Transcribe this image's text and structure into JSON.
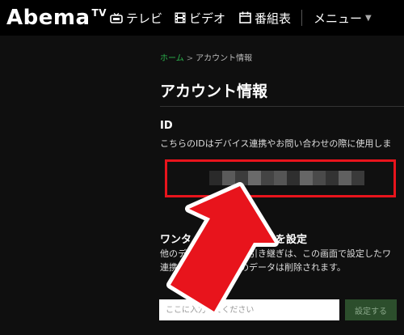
{
  "header": {
    "logo_text": "Abema",
    "logo_sup": "TV",
    "nav": {
      "tv_label": "テレビ",
      "video_label": "ビデオ",
      "guide_label": "番組表",
      "menu_label": "メニュー"
    }
  },
  "breadcrumb": {
    "home": "ホーム",
    "separator": ">",
    "current": "アカウント情報"
  },
  "page": {
    "title": "アカウント情報",
    "id_section": {
      "label": "ID",
      "description": "こちらのIDはデバイス連携やお問い合わせの際に使用しま"
    },
    "otp_section": {
      "title": "ワンタ　　　　　　ードを設定",
      "desc_line1": "他のデ　　　のデータ引き継ぎは、この画面で設定したワ",
      "desc_line2": "連携　　　　リストのデータは削除されます。"
    },
    "input": {
      "placeholder": "ここに入力してください",
      "value": ""
    },
    "set_button_label": "設定する"
  },
  "colors": {
    "background": "#0f0f0f",
    "header": "#000000",
    "accent_green": "#2bb24c",
    "highlight_red": "#e8141c"
  },
  "icons": [
    "tv-icon",
    "film-icon",
    "calendar-icon",
    "chevron-down-icon",
    "red-arrow-icon"
  ]
}
